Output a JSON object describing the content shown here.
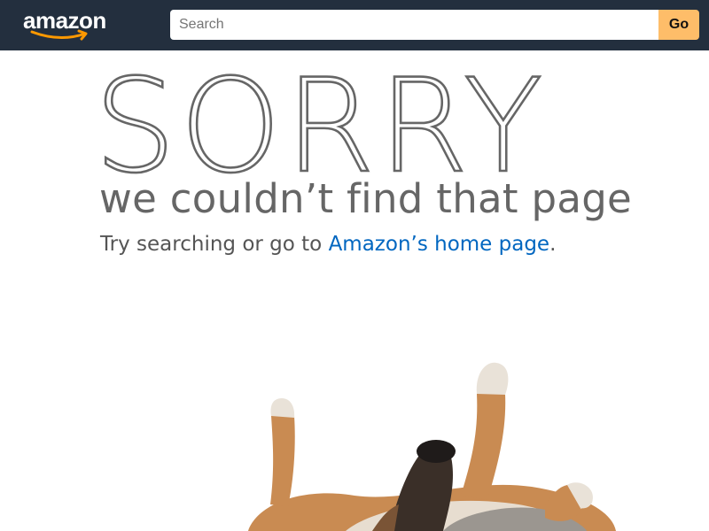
{
  "header": {
    "logo_text": "amazon",
    "colors": {
      "background": "#232f3e",
      "accent": "#febd69",
      "smile": "#ff9900"
    }
  },
  "search": {
    "placeholder": "Search",
    "value": "",
    "go_label": "Go"
  },
  "main": {
    "heading": "SORRY",
    "subheading": "we couldn’t find that page",
    "message_prefix": "Try searching or go to ",
    "link_text": "Amazon’s home page",
    "message_suffix": ".",
    "link_color": "#0066c0"
  },
  "illustration": {
    "icon": "dog-on-back-image"
  }
}
